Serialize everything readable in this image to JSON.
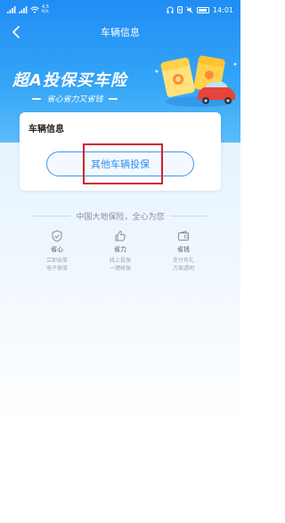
{
  "status_bar": {
    "network_label": "4.5 K/s",
    "time": "14:01"
  },
  "nav": {
    "title": "车辆信息"
  },
  "banner": {
    "title": "超A投保买车险",
    "subtitle": "省心省力又省钱"
  },
  "card": {
    "title": "车辆信息",
    "button_label": "其他车辆投保"
  },
  "slogan": "中国大地保险，全心为您",
  "features": [
    {
      "icon": "shield-icon",
      "title": "省心",
      "lines": [
        "立即出单",
        "电子保单"
      ]
    },
    {
      "icon": "thumb-icon",
      "title": "省力",
      "lines": [
        "线上投保",
        "一键续保"
      ]
    },
    {
      "icon": "wallet-icon",
      "title": "省钱",
      "lines": [
        "支付有礼",
        "方案透明"
      ]
    }
  ],
  "colors": {
    "brand_blue": "#1f8df4",
    "button_text": "#2f8cec",
    "highlight_red": "#d6202c"
  }
}
